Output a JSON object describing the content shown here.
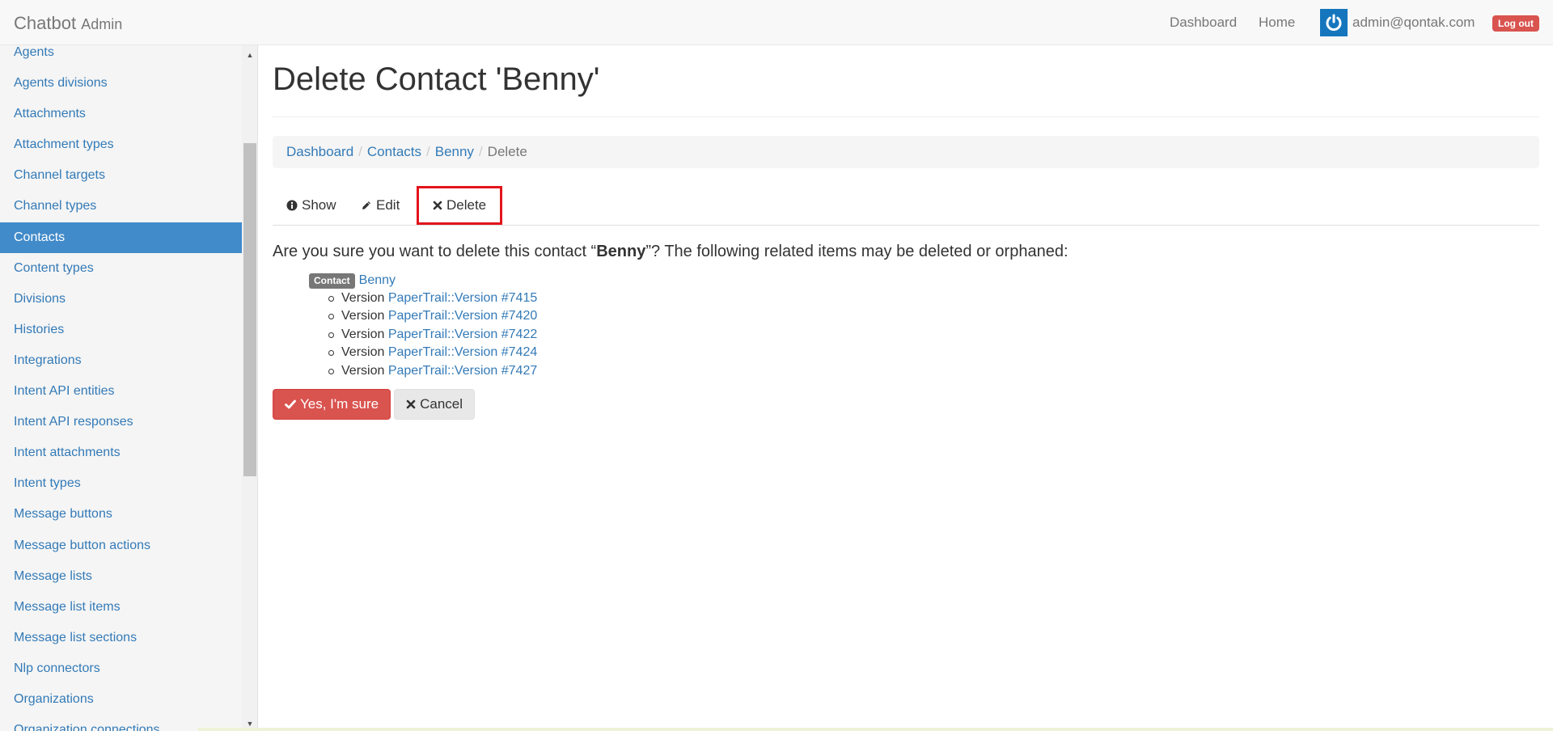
{
  "navbar": {
    "brand": "Chatbot",
    "brand_sub": "Admin",
    "links": [
      "Dashboard",
      "Home"
    ],
    "user_email": "admin@qontak.com",
    "logout_label": "Log out"
  },
  "sidebar": {
    "items": [
      {
        "label": "Agents",
        "active": false
      },
      {
        "label": "Agents divisions",
        "active": false
      },
      {
        "label": "Attachments",
        "active": false
      },
      {
        "label": "Attachment types",
        "active": false
      },
      {
        "label": "Channel targets",
        "active": false
      },
      {
        "label": "Channel types",
        "active": false
      },
      {
        "label": "Contacts",
        "active": true
      },
      {
        "label": "Content types",
        "active": false
      },
      {
        "label": "Divisions",
        "active": false
      },
      {
        "label": "Histories",
        "active": false
      },
      {
        "label": "Integrations",
        "active": false
      },
      {
        "label": "Intent API entities",
        "active": false
      },
      {
        "label": "Intent API responses",
        "active": false
      },
      {
        "label": "Intent attachments",
        "active": false
      },
      {
        "label": "Intent types",
        "active": false
      },
      {
        "label": "Message buttons",
        "active": false
      },
      {
        "label": "Message button actions",
        "active": false
      },
      {
        "label": "Message lists",
        "active": false
      },
      {
        "label": "Message list items",
        "active": false
      },
      {
        "label": "Message list sections",
        "active": false
      },
      {
        "label": "Nlp connectors",
        "active": false
      },
      {
        "label": "Organizations",
        "active": false
      },
      {
        "label": "Organization connections",
        "active": false
      }
    ]
  },
  "main": {
    "title": "Delete Contact 'Benny'",
    "breadcrumb": [
      {
        "label": "Dashboard",
        "active": false
      },
      {
        "label": "Contacts",
        "active": false
      },
      {
        "label": "Benny",
        "active": false
      },
      {
        "label": "Delete",
        "active": true
      }
    ],
    "breadcrumb_sep": "/",
    "tabs": {
      "show": "Show",
      "edit": "Edit",
      "delete": "Delete"
    },
    "confirm": {
      "prefix": "Are you sure you want to delete this contact “",
      "name": "Benny",
      "suffix": "”? The following related items may be deleted or orphaned:"
    },
    "related": {
      "badge": "Contact",
      "contact_name": "Benny",
      "versions": [
        {
          "type": "Version",
          "link": "PaperTrail::Version #7415"
        },
        {
          "type": "Version",
          "link": "PaperTrail::Version #7420"
        },
        {
          "type": "Version",
          "link": "PaperTrail::Version #7422"
        },
        {
          "type": "Version",
          "link": "PaperTrail::Version #7424"
        },
        {
          "type": "Version",
          "link": "PaperTrail::Version #7427"
        }
      ]
    },
    "buttons": {
      "confirm": "Yes, I'm sure",
      "cancel": "Cancel"
    }
  },
  "colors": {
    "primary": "#337ab7",
    "active_sidebar": "#428bca",
    "danger": "#d9534f",
    "highlight_border": "#e3141c"
  }
}
